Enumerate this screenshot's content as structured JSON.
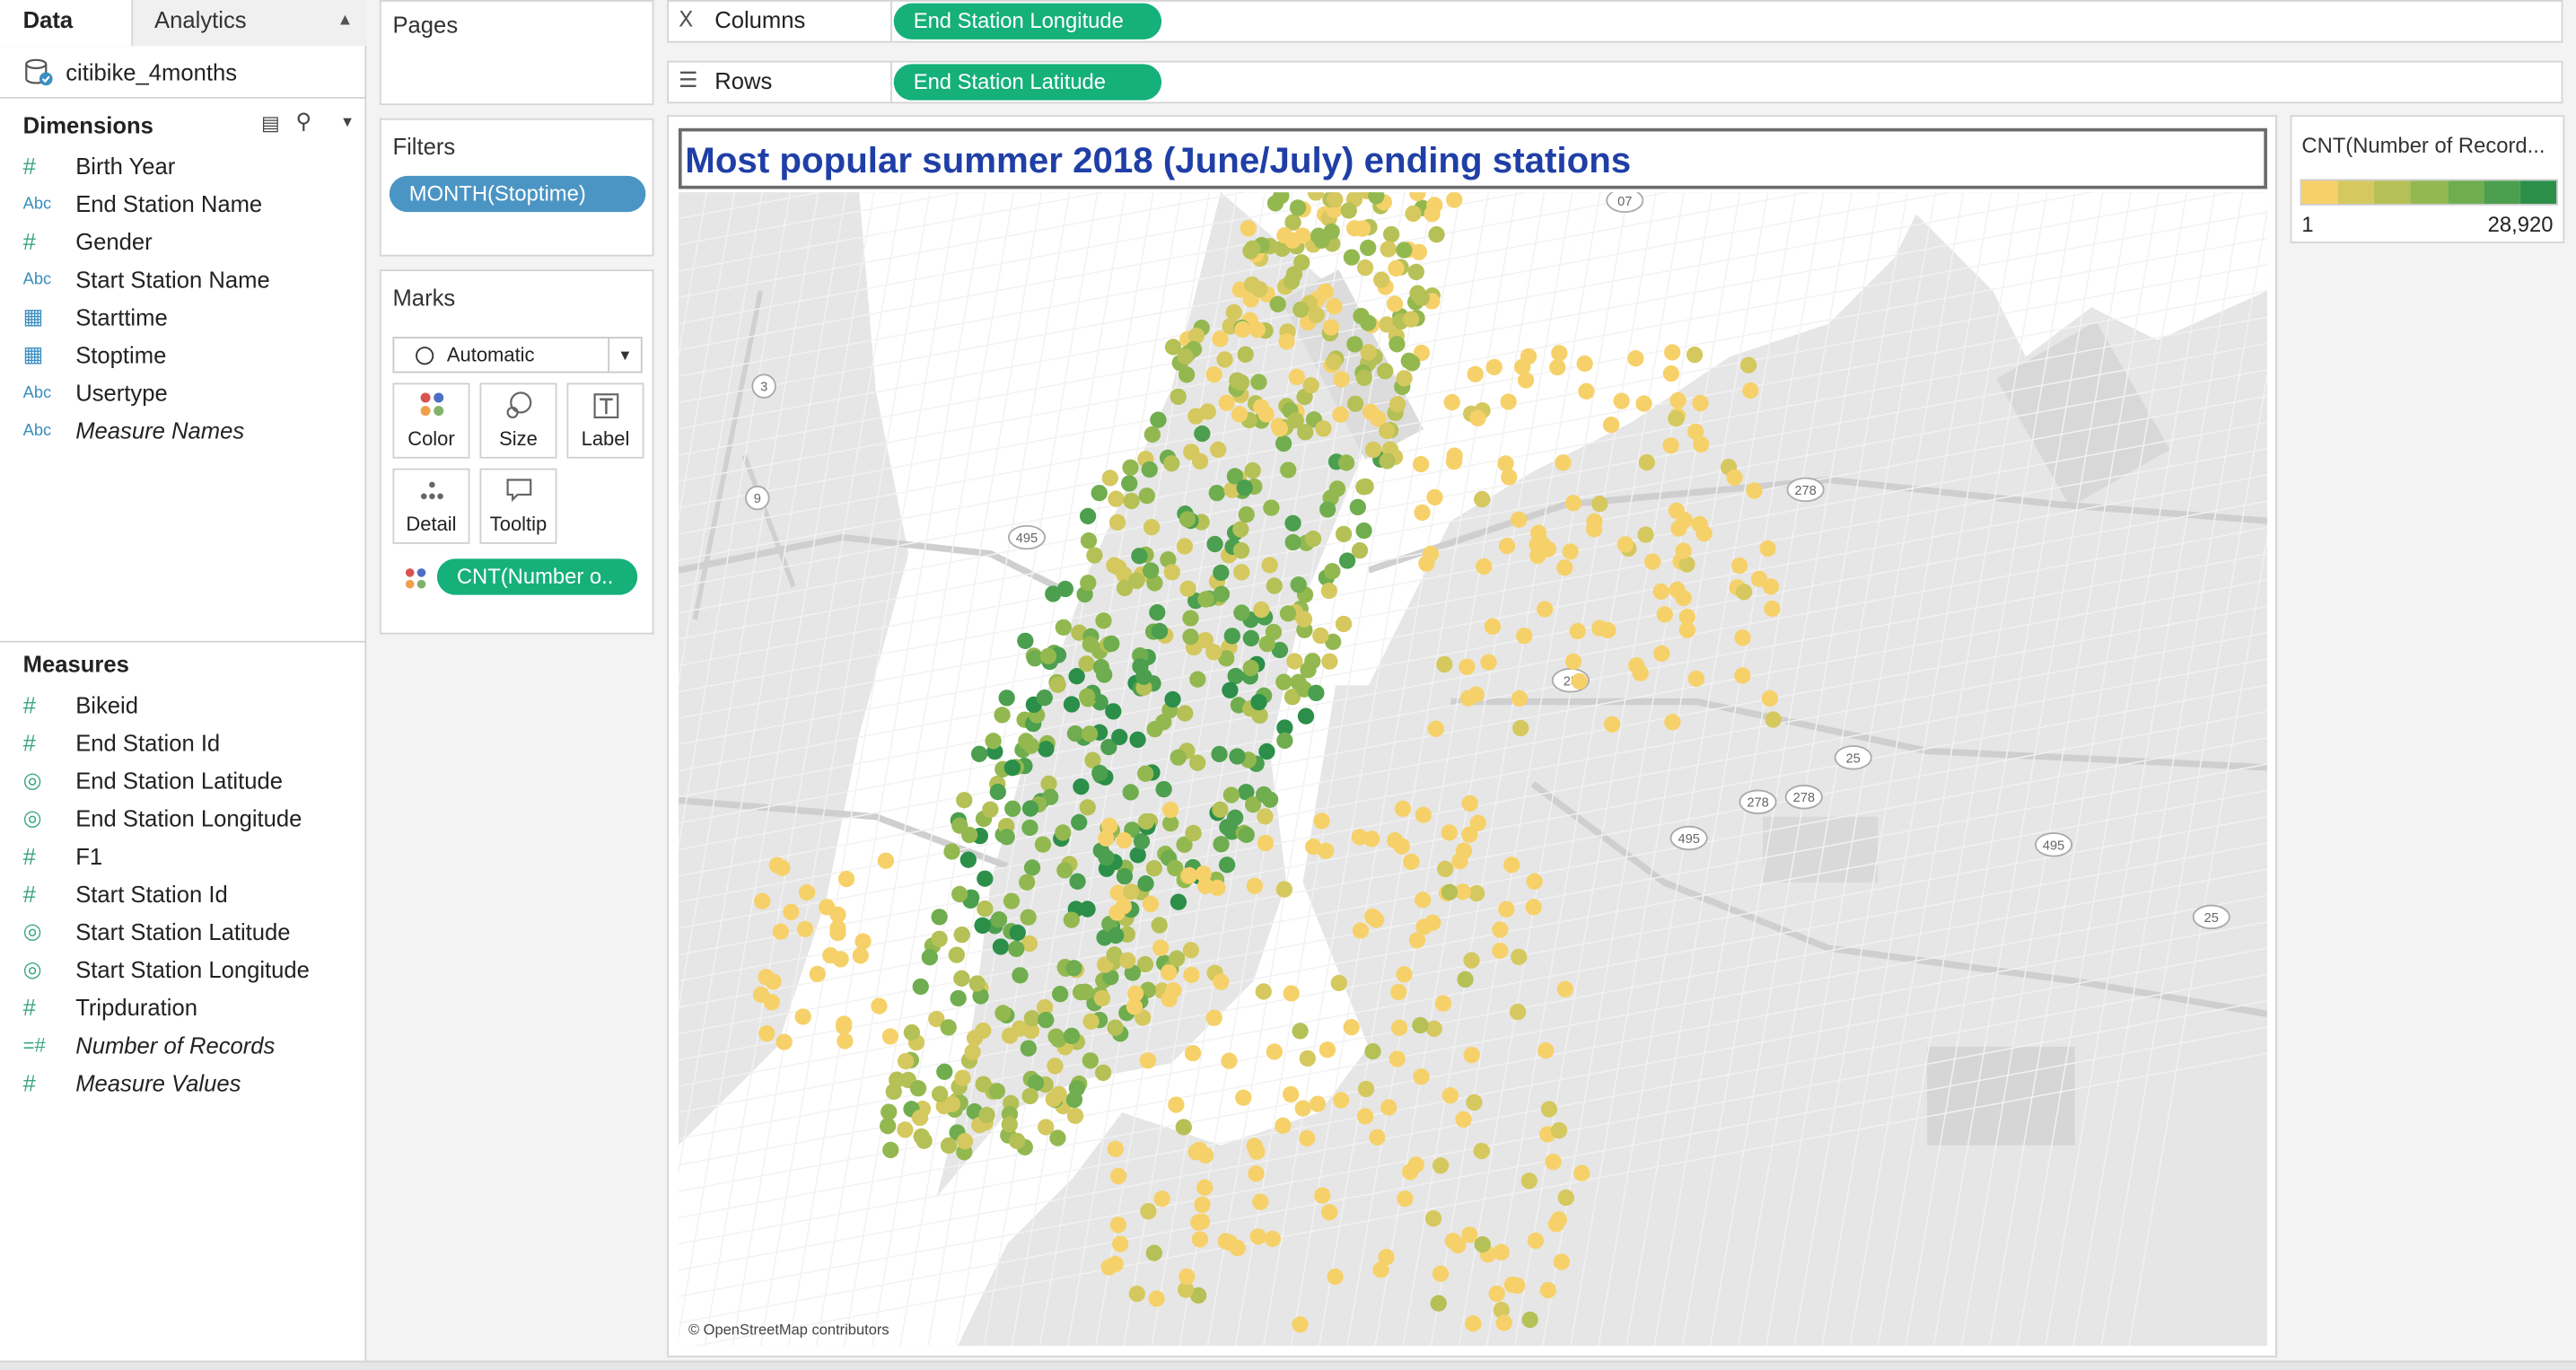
{
  "tabs": {
    "data": "Data",
    "analytics": "Analytics"
  },
  "datasource": "citibike_4months",
  "dimensions": {
    "header": "Dimensions",
    "items": [
      {
        "type": "#",
        "label": "Birth Year",
        "icon": "number-icon"
      },
      {
        "type": "Abc",
        "label": "End Station Name",
        "icon": "string-icon"
      },
      {
        "type": "#",
        "label": "Gender",
        "icon": "number-icon"
      },
      {
        "type": "Abc",
        "label": "Start Station Name",
        "icon": "string-icon"
      },
      {
        "type": "cal",
        "label": "Starttime",
        "icon": "datetime-icon"
      },
      {
        "type": "cal",
        "label": "Stoptime",
        "icon": "datetime-icon"
      },
      {
        "type": "Abc",
        "label": "Usertype",
        "icon": "string-icon"
      },
      {
        "type": "Abc",
        "label": "Measure Names",
        "icon": "string-icon",
        "italic": true
      }
    ]
  },
  "measures": {
    "header": "Measures",
    "items": [
      {
        "type": "#",
        "label": "Bikeid",
        "icon": "number-icon"
      },
      {
        "type": "#",
        "label": "End Station Id",
        "icon": "number-icon"
      },
      {
        "type": "geo",
        "label": "End Station Latitude",
        "icon": "globe-icon"
      },
      {
        "type": "geo",
        "label": "End Station Longitude",
        "icon": "globe-icon"
      },
      {
        "type": "#",
        "label": "F1",
        "icon": "number-icon"
      },
      {
        "type": "#",
        "label": "Start Station Id",
        "icon": "number-icon"
      },
      {
        "type": "geo",
        "label": "Start Station Latitude",
        "icon": "globe-icon"
      },
      {
        "type": "geo",
        "label": "Start Station Longitude",
        "icon": "globe-icon"
      },
      {
        "type": "#",
        "label": "Tripduration",
        "icon": "number-icon"
      },
      {
        "type": "=#",
        "label": "Number of Records",
        "icon": "calc-number-icon",
        "italic": true
      },
      {
        "type": "#",
        "label": "Measure Values",
        "icon": "number-icon",
        "italic": true
      }
    ]
  },
  "pages": {
    "title": "Pages"
  },
  "filters": {
    "title": "Filters",
    "pill": "MONTH(Stoptime)"
  },
  "marks": {
    "title": "Marks",
    "type": "Automatic",
    "buttons": [
      "Color",
      "Size",
      "Label",
      "Detail",
      "Tooltip"
    ],
    "color_pill": "CNT(Number o.."
  },
  "columns": {
    "label": "Columns",
    "pill": "End Station Longitude"
  },
  "rows": {
    "label": "Rows",
    "pill": "End Station Latitude"
  },
  "view": {
    "title": "Most popular summer 2018 (June/July) ending stations",
    "attribution": "© OpenStreetMap contributors"
  },
  "legend": {
    "title": "CNT(Number of Record...",
    "min": "1",
    "max": "28,920",
    "colors": [
      "#f6d16a",
      "#d5c85f",
      "#b5c056",
      "#93b850",
      "#6fad4f",
      "#4b9f4e",
      "#2b8f49"
    ]
  },
  "map_labels": [
    "3",
    "9",
    "495",
    "25",
    "278",
    "278",
    "25",
    "495",
    "495",
    "25",
    "278",
    "07"
  ]
}
